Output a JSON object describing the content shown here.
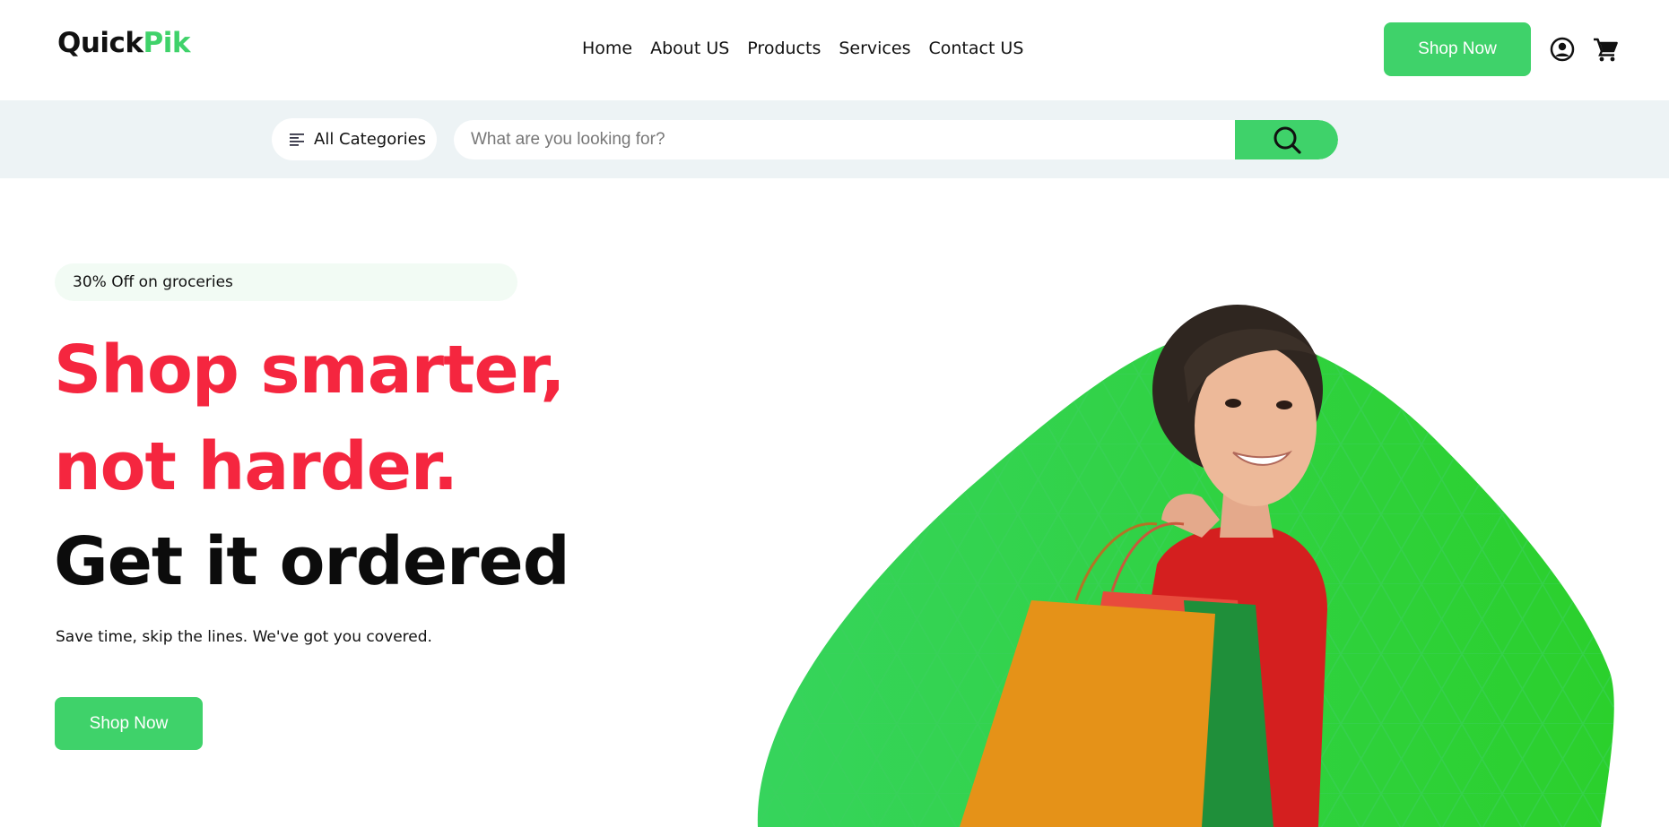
{
  "header": {
    "logo_part1": "Quick",
    "logo_part2": "Pik",
    "nav": [
      "Home",
      "About US",
      "Products",
      "Services",
      "Contact US"
    ],
    "shop_button": "Shop Now",
    "account_icon": "user-circle-icon",
    "cart_icon": "shopping-cart-icon"
  },
  "search_bar": {
    "categories_label": "All Categories",
    "categories_icon": "menu-lines-icon",
    "placeholder": "What are you looking for?",
    "search_icon": "search-icon"
  },
  "hero": {
    "promo": "30% Off on groceries",
    "line1": "Shop smarter,",
    "line2": "not harder.",
    "line3": "Get it ordered",
    "subtitle": "Save time, skip the lines. We've got you covered.",
    "cta": "Shop Now",
    "image_alt": "Smiling woman carrying shopping bags over green blob"
  },
  "colors": {
    "accent_green": "#3fd26a",
    "headline_red": "#f5263f",
    "band_bg": "#edf3f5"
  }
}
